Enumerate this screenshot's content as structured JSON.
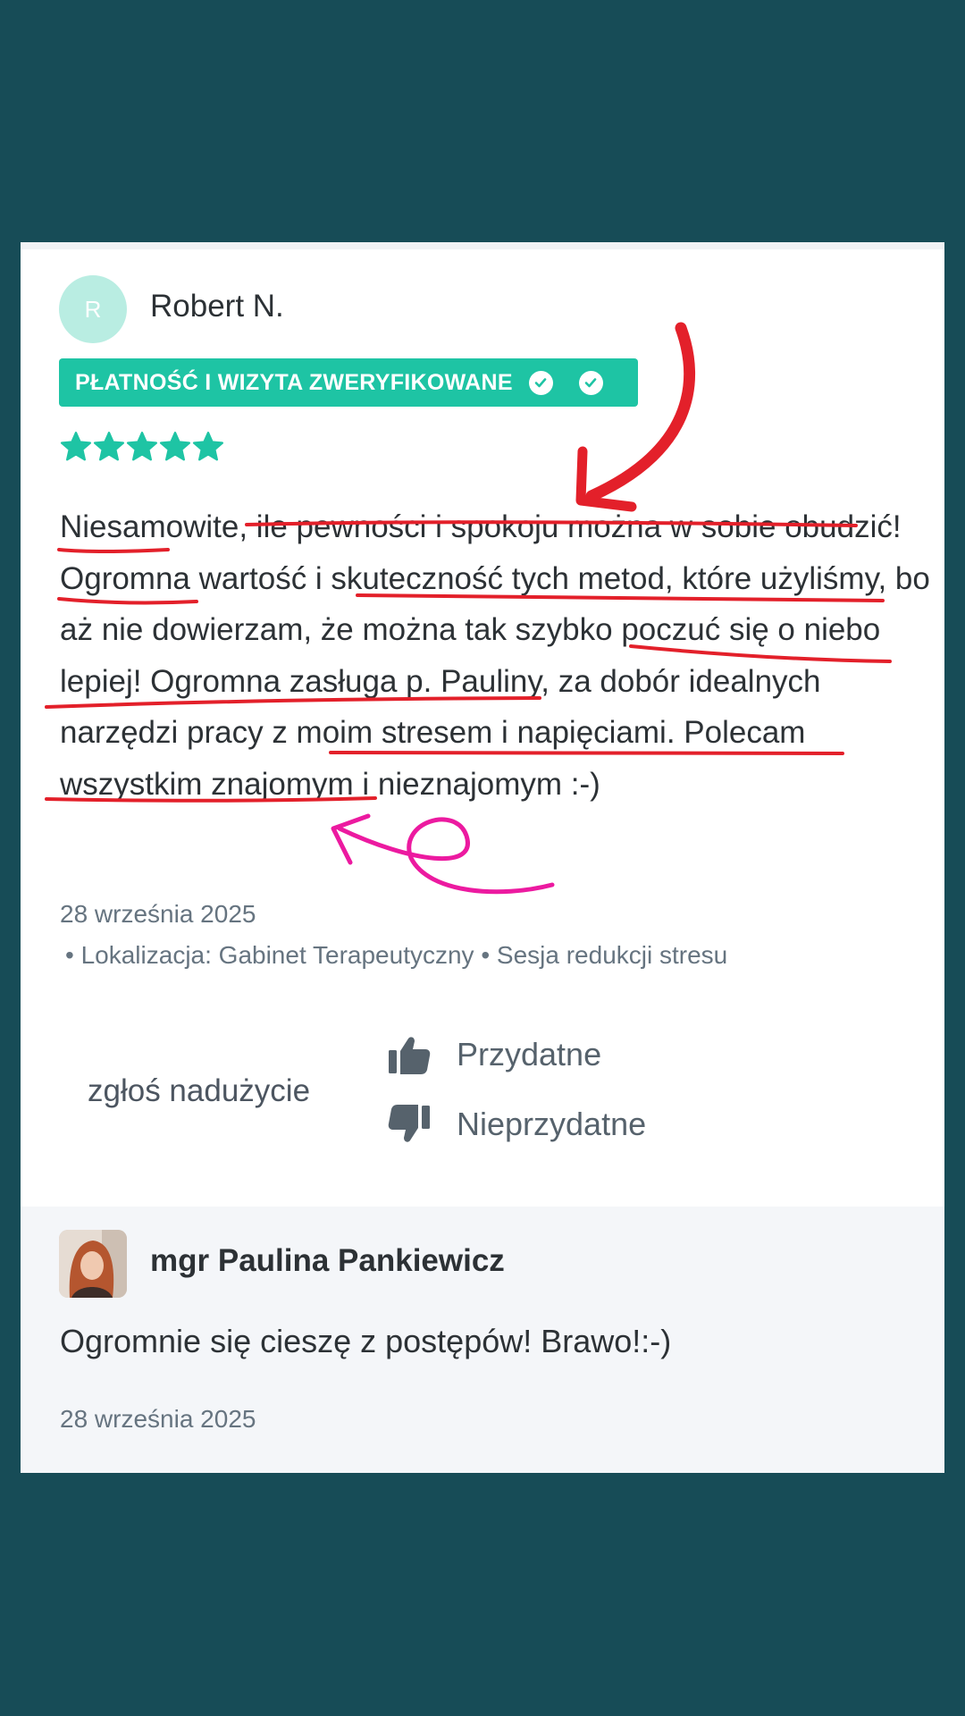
{
  "review": {
    "author_initial": "R",
    "author_name": "Robert N.",
    "verified_label": "PŁATNOŚĆ I WIZYTA ZWERYFIKOWANE",
    "rating": 5,
    "rating_max": 5,
    "star_icon": "star-icon",
    "text": "Niesamowite, ile pewności i spokoju można w sobie obudzić! Ogromna wartość i skuteczność tych metod, które użyliśmy, bo aż nie dowierzam, że można tak szybko poczuć się o niebo lepiej! Ogromna zasługa p. Pauliny, za dobór idealnych narzędzi pracy z moim stresem i napięciami. Polecam wszystkim znajomym i nieznajomym :-)",
    "date": "28 września 2025",
    "meta": "• Lokalizacja: Gabinet Terapeutyczny • Sesja redukcji stresu"
  },
  "actions": {
    "report": "zgłoś nadużycie",
    "helpful": "Przydatne",
    "not_helpful": "Nieprzydatne"
  },
  "reply": {
    "author_name": "mgr Paulina Pankiewicz",
    "text": "Ogromnie się cieszę z postępów! Brawo!:-)",
    "date": "28 września 2025"
  },
  "colors": {
    "background": "#174c57",
    "accent": "#1ec4a4",
    "annotation_red": "#e3202a",
    "annotation_pink": "#ec1aa0"
  }
}
